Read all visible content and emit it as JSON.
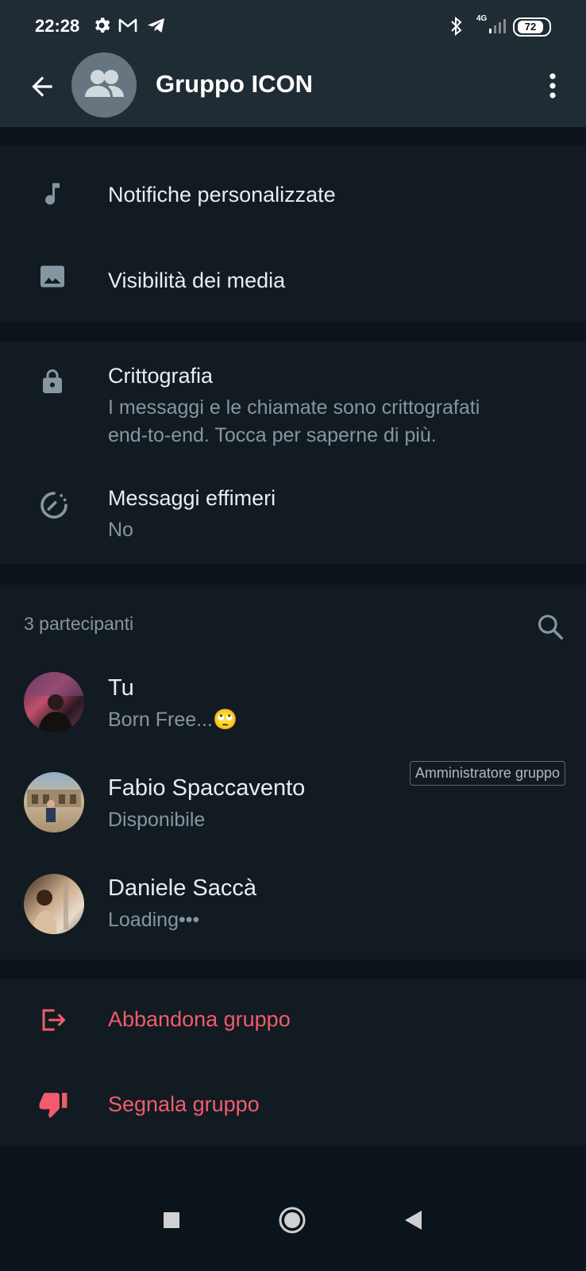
{
  "status_bar": {
    "time": "22:28",
    "battery": "72",
    "network": "4G",
    "icons": [
      "settings-icon",
      "gmail-icon",
      "telegram-icon",
      "bluetooth-icon",
      "signal-icon",
      "battery-icon"
    ]
  },
  "header": {
    "title": "Gruppo ICON",
    "icons": [
      "back-arrow-icon",
      "group-avatar-icon",
      "more-vert-icon"
    ]
  },
  "settings": {
    "notifications_label": "Notifiche personalizzate",
    "media_visibility_label": "Visibilità dei media",
    "encryption_title": "Crittografia",
    "encryption_line1": "I messaggi e le chiamate sono crittografati",
    "encryption_line2": "end-to-end. Tocca per saperne di più.",
    "ephemeral_title": "Messaggi effimeri",
    "ephemeral_value": "No"
  },
  "participants": {
    "count_label": "3 partecipanti",
    "items": [
      {
        "name": "Tu",
        "status": "Born Free...🙄",
        "badge": ""
      },
      {
        "name": "Fabio Spaccavento",
        "status": "Disponibile",
        "badge": "Amministratore gruppo"
      },
      {
        "name": "Daniele Saccà",
        "status": "Loading•••",
        "badge": ""
      }
    ]
  },
  "actions": {
    "leave_label": "Abbandona gruppo",
    "report_label": "Segnala gruppo"
  },
  "colors": {
    "header_bg": "#1f2c34",
    "page_bg": "#0b141a",
    "section_bg": "#111b21",
    "danger": "#f15c6d",
    "secondary_text": "#8696a0"
  }
}
